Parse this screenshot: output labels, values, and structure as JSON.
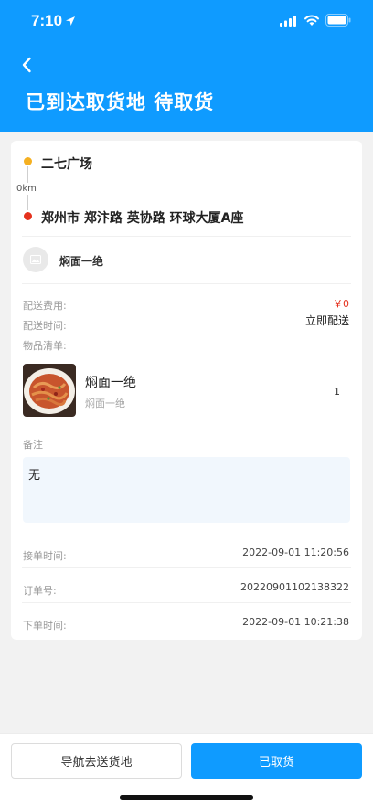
{
  "status_bar": {
    "time": "7:10"
  },
  "header": {
    "title": "已到达取货地 待取货"
  },
  "route": {
    "pickup_address": "二七广场",
    "distance": "0km",
    "delivery_address": "郑州市 郑汴路 英协路 环球大厦A座"
  },
  "shop": {
    "name": "焖面一绝"
  },
  "order_info": {
    "fee_label": "配送费用:",
    "fee_value": "￥0",
    "time_label": "配送时间:",
    "time_value": "立即配送",
    "items_label": "物品清单:"
  },
  "items": [
    {
      "name": "焖面一绝",
      "sub": "焖面一绝",
      "qty": "1"
    }
  ],
  "remark": {
    "label": "备注",
    "text": "无"
  },
  "meta": [
    {
      "label": "接单时间:",
      "value": "2022-09-01 11:20:56"
    },
    {
      "label": "订单号:",
      "value": "20220901102138322"
    },
    {
      "label": "下单时间:",
      "value": "2022-09-01 10:21:38"
    }
  ],
  "actions": {
    "navigate_label": "导航去送货地",
    "picked_label": "已取货"
  },
  "colors": {
    "primary": "#0f9bff",
    "fee": "#e5321e",
    "start_dot": "#f5b021",
    "end_dot": "#e5321e"
  }
}
